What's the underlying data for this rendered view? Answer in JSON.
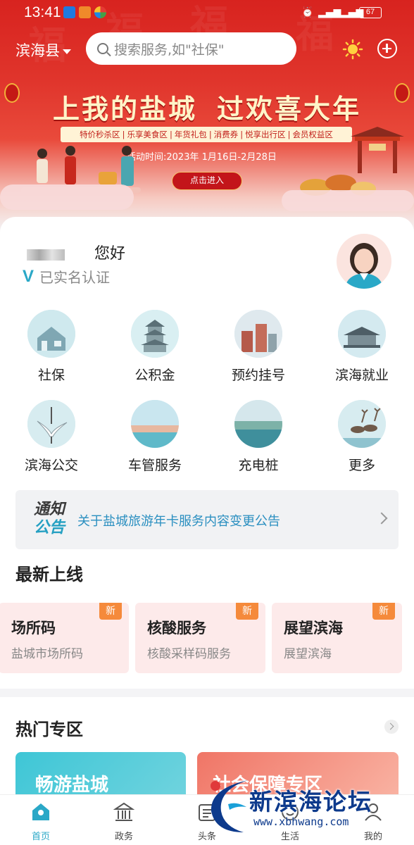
{
  "status_bar": {
    "time": "13:41",
    "battery": "67"
  },
  "header": {
    "region": "滨海县",
    "search_placeholder": "搜索服务,如\"社保\""
  },
  "banner": {
    "title_left": "上我的盐城",
    "title_right": "过欢喜大年",
    "tags": [
      "特价秒杀区",
      "乐享美食区",
      "年货礼包",
      "消费券",
      "悦享出行区",
      "会员权益区"
    ],
    "date": "活动时间:2023年 1月16日-2月28日",
    "button": "点击进入"
  },
  "user": {
    "greeting": "您好",
    "verified_mark": "V",
    "verified_text": "已实名认证"
  },
  "services": [
    {
      "label": "社保",
      "icon": "house-icon"
    },
    {
      "label": "公积金",
      "icon": "pagoda-icon"
    },
    {
      "label": "预约挂号",
      "icon": "hospital-icon"
    },
    {
      "label": "滨海就业",
      "icon": "pavilion-icon"
    },
    {
      "label": "滨海公交",
      "icon": "crane-bird-icon"
    },
    {
      "label": "车管服务",
      "icon": "sea-icon"
    },
    {
      "label": "充电桩",
      "icon": "wetland-icon"
    },
    {
      "label": "更多",
      "icon": "deer-icon"
    }
  ],
  "notice": {
    "tag_line1": "通知",
    "tag_line2": "公告",
    "text": "关于盐城旅游年卡服务内容变更公告"
  },
  "latest": {
    "title": "最新上线",
    "badge": "新",
    "cards": [
      {
        "title": "场所码",
        "subtitle": "盐城市场所码"
      },
      {
        "title": "核酸服务",
        "subtitle": "核酸采样码服务"
      },
      {
        "title": "展望滨海",
        "subtitle": "展望滨海"
      }
    ]
  },
  "hot": {
    "title": "热门专区",
    "cards": [
      {
        "title": "畅游盐城"
      },
      {
        "title": "社会保障专区"
      }
    ]
  },
  "bottom_nav": [
    {
      "label": "首页",
      "active": true
    },
    {
      "label": "政务",
      "active": false
    },
    {
      "label": "头条",
      "active": false
    },
    {
      "label": "生活",
      "active": false
    },
    {
      "label": "我的",
      "active": false
    }
  ],
  "watermark": {
    "brand": "新滨海论坛",
    "url": "www.xbhwang.com"
  },
  "colors": {
    "banner_red": "#d8231f",
    "accent_teal": "#2aa8c7",
    "notice_blue": "#2a8fc0",
    "badge_orange": "#f58a3b"
  }
}
